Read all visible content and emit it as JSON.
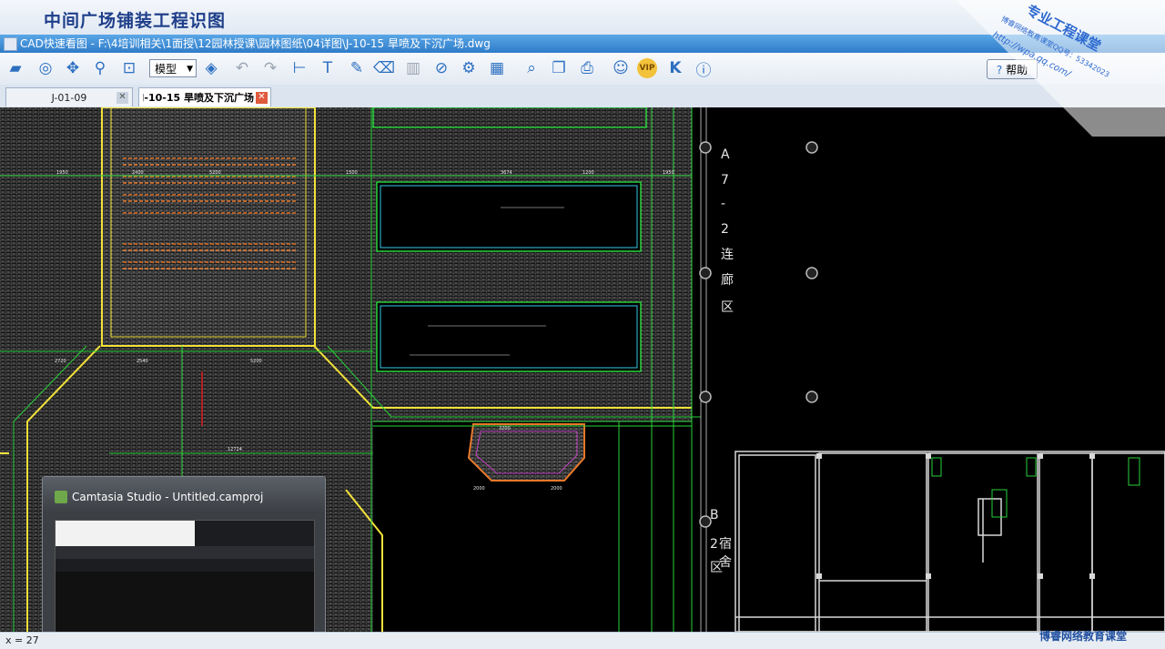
{
  "course_title": "中间广场铺装工程识图",
  "window": {
    "title": "CAD快速看图 - F:\\4培训相关\\1面授\\12园林授课\\园林图纸\\04详图\\J-10-15 旱喷及下沉广场.dwg"
  },
  "toolbar": {
    "view_mode": "模型",
    "help_label": "帮助",
    "vip_label": "VIP"
  },
  "tabs": [
    {
      "label": "J-01-09",
      "active": false
    },
    {
      "label": "J-10-15 旱喷及下沉广场",
      "active": true
    }
  ],
  "drawing": {
    "zone_a": [
      "A",
      "7",
      "-",
      "2",
      "连",
      "廊",
      "区"
    ],
    "zone_b": [
      "B",
      "2",
      "宿",
      "舍",
      "区"
    ]
  },
  "recorder": {
    "title": "Camtasia Studio - Untitled.camproj"
  },
  "status": {
    "coord": "x = 27"
  },
  "watermark": {
    "line1": "专业工程课堂",
    "line2": "博睿网络教育课堂QQ号：53342023",
    "line3": "http://wpa.qq.com/",
    "bottom_logo": "博睿网络教育课堂"
  },
  "colors": {
    "accent": "#2f7cc9",
    "cad_background": "#000000",
    "cad_green": "#28d23a",
    "cad_yellow": "#f2e23a",
    "cad_cyan": "#34c8e6",
    "cad_orange": "#e8782a",
    "cad_white": "#e6e6e6"
  }
}
